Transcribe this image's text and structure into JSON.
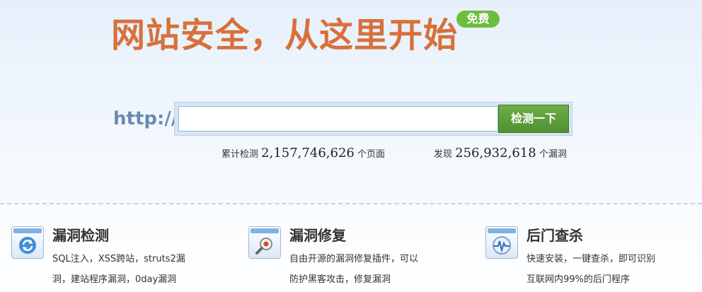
{
  "hero": {
    "title": "网站安全，从这里开始",
    "badge": "免费"
  },
  "search": {
    "prefix": "http://",
    "value": "",
    "placeholder": "",
    "button_label": "检测一下"
  },
  "stats": {
    "scanned_label": "累计检测",
    "scanned_value": "2,157,746,626",
    "scanned_unit": "个页面",
    "found_label": "发现",
    "found_value": "256,932,618",
    "found_unit": "个漏洞"
  },
  "features": [
    {
      "title": "漏洞检测",
      "line1": "SQL注入，XSS跨站，struts2漏",
      "line2": "洞，建站程序漏洞，0day漏洞",
      "icon": "refresh-icon"
    },
    {
      "title": "漏洞修复",
      "line1": "自由开源的漏洞修复插件，可以",
      "line2": "防护黑客攻击，修复漏洞",
      "icon": "magnifier-icon"
    },
    {
      "title": "后门查杀",
      "line1": "快速安装，一键查杀，即可识别",
      "line2": "互联网内99%的后门程序",
      "icon": "pulse-icon"
    }
  ],
  "colors": {
    "accent": "#d8703a",
    "button": "#5a9e38",
    "badge": "#6fbd3d",
    "link": "#6a8ab2"
  }
}
